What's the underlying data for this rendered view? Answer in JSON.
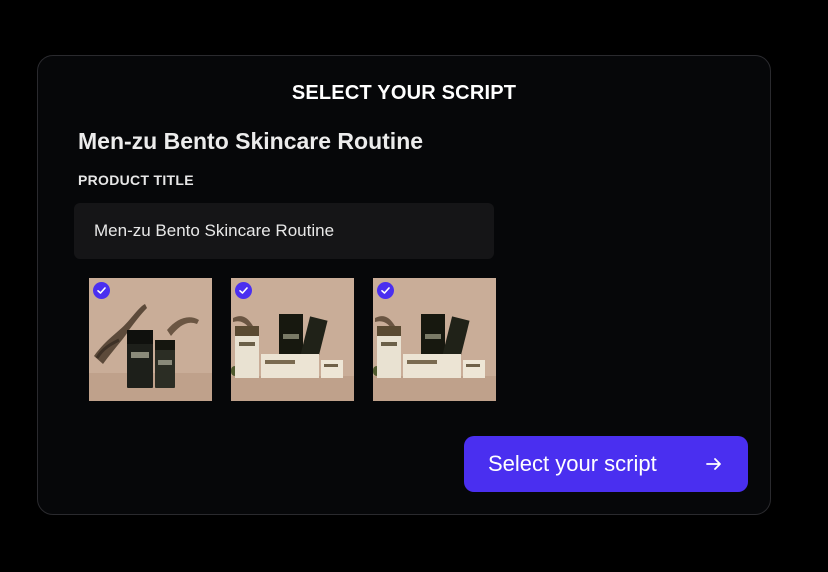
{
  "header": {
    "title": "SELECT YOUR SCRIPT"
  },
  "product": {
    "name": "Men-zu Bento Skincare Routine",
    "field_label": "PRODUCT TITLE",
    "title_value": "Men-zu Bento Skincare Routine"
  },
  "images": [
    {
      "selected": true
    },
    {
      "selected": true
    },
    {
      "selected": true
    }
  ],
  "action": {
    "label": "Select your script",
    "icon": "arrow-right-icon"
  },
  "colors": {
    "accent": "#4a2ff0",
    "background": "#000000",
    "card": "#060709",
    "input": "#151517"
  }
}
